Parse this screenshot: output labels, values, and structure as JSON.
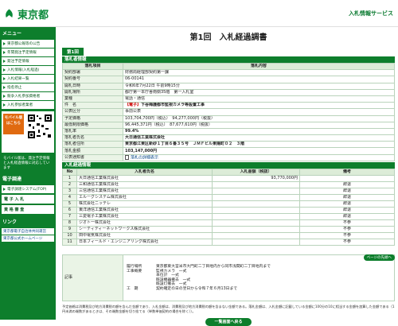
{
  "header": {
    "logo_text": "東京都",
    "service_name": "入札情報サービス"
  },
  "sidebar": {
    "menu_heading": "メニュー",
    "items": [
      {
        "label": "東京都公報等の公告"
      },
      {
        "label": "年間発注予定情報"
      },
      {
        "label": "発注予定情報"
      },
      {
        "label": "入札情報(入札経過)"
      },
      {
        "label": "入札結果一覧"
      },
      {
        "label": "指名停止"
      },
      {
        "label": "競争入札参加資格者"
      },
      {
        "label": "入札参加者業者"
      }
    ],
    "mobile_tag": "モバイル版 はこちら",
    "mobile_note": "モバイル版は、発注予定情報と入札経過情報に対応しています",
    "system_heading": "電子調達",
    "system_label": "電子調達システム(TOP)",
    "buttons": [
      {
        "label": "電 子 入 札"
      },
      {
        "label": "資 格 審 査"
      }
    ],
    "links_heading": "リンク",
    "links": [
      {
        "label": "東京都電子自治体共同運営"
      },
      {
        "label": "東京都公式ホームページ"
      }
    ]
  },
  "page": {
    "title": "第1回　入札経過調書",
    "tab_label": "第1回"
  },
  "info": {
    "section_label": "落札者情報",
    "col_item": "落札項目",
    "col_content": "落札内容",
    "rows": [
      {
        "label": "契約部署",
        "value": "財務局経理部契約第一課"
      },
      {
        "label": "契約番号",
        "value": "06-00141"
      },
      {
        "label": "開札日時",
        "value": "令和6年7月22日 午前9時15分"
      },
      {
        "label": "開札場所",
        "value": "都庁第一本庁舎南側35階　第一入札室"
      },
      {
        "label": "業種",
        "value": "電話・通信"
      },
      {
        "label": "件　名",
        "value_tag": "【電子】",
        "value": "下谷梅護都市監視カメラ等設置工事"
      },
      {
        "label": "公表区分",
        "value": "事前公表"
      },
      {
        "label": "予定価格",
        "value": "103,704,700円（税込）　94,277,000円（税抜）"
      },
      {
        "label": "最低制限価格",
        "value": "96,445,371円（税込）　87,677,610円（税抜）"
      },
      {
        "label": "落札率",
        "value": "99.4%"
      },
      {
        "label": "落札者氏名",
        "value": "大日通信工業株式会社"
      },
      {
        "label": "落札者住所",
        "value": "東京都江東区新砂１丁目６番３５号　ＪＭＦビル東陽町０２　３階"
      },
      {
        "label": "落札金額",
        "value": "103,147,000円"
      }
    ],
    "notice_label": "公表通知書",
    "notice_link": "落札の詳細表示"
  },
  "bids": {
    "section_label": "入札経過情報",
    "col_no": "No",
    "col_name": "入札者氏名",
    "col_amount": "入札金額（税抜）",
    "col_note": "備考",
    "rows": [
      {
        "no": "1",
        "name": "大日通信工業株式会社",
        "amount": "93,770,000円",
        "note": ""
      },
      {
        "no": "2",
        "name": "三和通信工業株式会社",
        "amount": "",
        "note": "辞退"
      },
      {
        "no": "3",
        "name": "三信通信工業株式会社",
        "amount": "",
        "note": "辞退"
      },
      {
        "no": "4",
        "name": "エルーグシステム株式会社",
        "amount": "",
        "note": "辞退"
      },
      {
        "no": "5",
        "name": "株式会社ニッテレ",
        "amount": "",
        "note": "辞退"
      },
      {
        "no": "6",
        "name": "東洋通信工業株式会社",
        "amount": "",
        "note": "辞退"
      },
      {
        "no": "7",
        "name": "三愛電子工業株式会社",
        "amount": "",
        "note": "辞退"
      },
      {
        "no": "8",
        "name": "ジオト一株式会社",
        "amount": "",
        "note": "不参"
      },
      {
        "no": "9",
        "name": "シーティディーネットワークス株式会社",
        "amount": "",
        "note": "不参"
      },
      {
        "no": "10",
        "name": "田中電気株式会社",
        "amount": "",
        "note": "不参"
      },
      {
        "no": "11",
        "name": "日本フィールド・エンジニアリング株式会社",
        "amount": "",
        "note": "不参"
      }
    ],
    "top_button": "ページの先頭へ"
  },
  "remarks": {
    "label": "記事",
    "lines": [
      {
        "k": "履行場所",
        "v": "東京都東大宮米市大門町二丁目地内から同市浅間町二丁目地内まで"
      },
      {
        "k": "工事概要",
        "v": "監視カメラ　一式"
      },
      {
        "k": "",
        "v": "本位計　一式"
      },
      {
        "k": "",
        "v": "既設機器撤去　一式"
      },
      {
        "k": "",
        "v": "既設灯撤去　一式"
      },
      {
        "k": "工　期",
        "v": "契約確定の日の翌日から令和７年６月13日まで"
      }
    ]
  },
  "footnote": "予定価格は消費税及び地方消費税の額を含んだ金額であり、入札金額は、消費税及び地方消費税の額を含まない金額である。落札金額は、入札金額に記載している金額に100分の10に相当する金額を加算した金額である（1円未満の端数があるときは、その端数金額を切り捨てる（単数単価契約の場合を除く））。",
  "back_button": "一覧画面へ戻る",
  "colors": {
    "brand_green": "#0d7e2c",
    "alert_red": "#cc0000"
  }
}
